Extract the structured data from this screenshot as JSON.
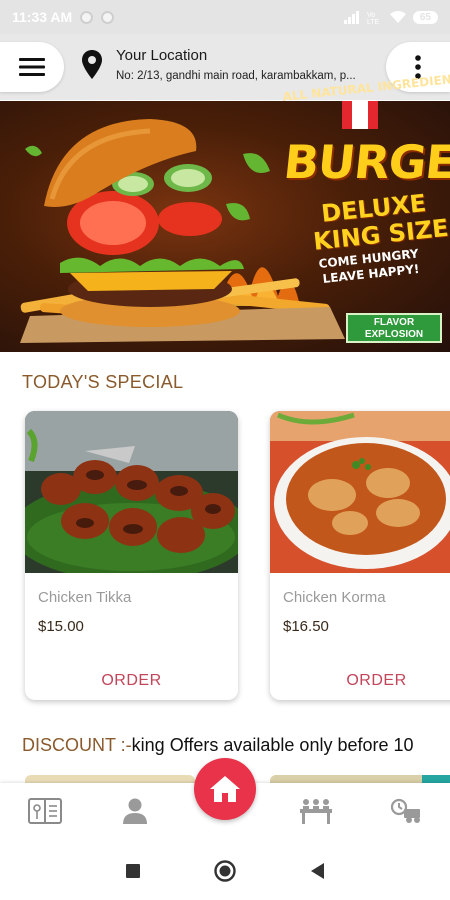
{
  "status_bar": {
    "time": "11:33 AM",
    "battery": "65"
  },
  "header": {
    "location_title": "Your Location",
    "location_address": "No: 2/13, gandhi main road, karambakkam, p..."
  },
  "banner": {
    "title": "BURGER",
    "line_natural": "ALL NATURAL INGREDIENTS!",
    "line_deluxe": "DELUXE",
    "line_king": "KING SIZE",
    "line_come": "COME HUNGRY",
    "line_leave": "LEAVE HAPPY!",
    "badge": "FLAVOR EXPLOSION"
  },
  "sections": {
    "special_title": "TODAY'S SPECIAL",
    "discount_label": "DISCOUNT :-",
    "discount_text": "king Offers available only before 10"
  },
  "specials": [
    {
      "name": "Chicken Tikka",
      "price": "$15.00",
      "order_label": "ORDER"
    },
    {
      "name": "Chicken Korma",
      "price": "$16.50",
      "order_label": "ORDER"
    }
  ],
  "nav": {
    "items": [
      "menu-book-icon",
      "profile-icon",
      "home-icon",
      "dining-table-icon",
      "delivery-icon"
    ]
  },
  "colors": {
    "accent": "#e8334a",
    "section_title": "#8a5a2c",
    "order": "#c2455a"
  }
}
